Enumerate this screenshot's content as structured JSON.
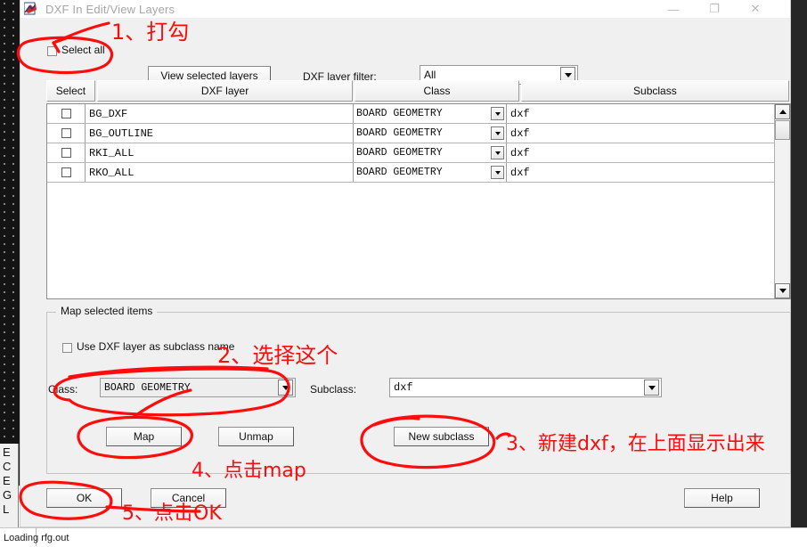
{
  "window": {
    "title": "DXF In Edit/View Layers",
    "icon": "dxf-app-icon",
    "minimize_label": "—",
    "maximize_label": "❐",
    "close_label": "✕"
  },
  "toolbar": {
    "select_all_label": "Select all",
    "view_selected_layers_label": "View selected layers",
    "dxf_layer_filter_label": "DXF layer filter:",
    "dxf_layer_filter_value": "All"
  },
  "table": {
    "columns": [
      "Select",
      "DXF layer",
      "Class",
      "Subclass"
    ],
    "rows": [
      {
        "select": "",
        "layer": "BG_DXF",
        "class": "BOARD GEOMETRY",
        "subclass": "dxf"
      },
      {
        "select": "",
        "layer": "BG_OUTLINE",
        "class": "BOARD GEOMETRY",
        "subclass": "dxf"
      },
      {
        "select": "",
        "layer": "RKI_ALL",
        "class": "BOARD GEOMETRY",
        "subclass": "dxf"
      },
      {
        "select": "",
        "layer": "RKO_ALL",
        "class": "BOARD GEOMETRY",
        "subclass": "dxf"
      }
    ]
  },
  "map_group": {
    "legend": "Map selected items",
    "use_dxf_layer_label": "Use DXF layer as subclass name",
    "class_label": "Class:",
    "class_value": "BOARD GEOMETRY",
    "subclass_label": "Subclass:",
    "subclass_value": "dxf",
    "map_label": "Map",
    "unmap_label": "Unmap",
    "new_subclass_label": "New subclass"
  },
  "footer": {
    "ok_label": "OK",
    "cancel_label": "Cancel",
    "help_label": "Help"
  },
  "background": {
    "left_letters": [
      "E",
      "C",
      "E",
      "G",
      "L"
    ],
    "status_text": "Loading rfg.out"
  },
  "annotations": {
    "color": "#fb0d0d",
    "step1": "1、打勾",
    "step2": "2、选择这个",
    "step3": "3、新建dxf，在上面显示出来",
    "step4": "4、点击map",
    "step5": "5、点击OK"
  }
}
